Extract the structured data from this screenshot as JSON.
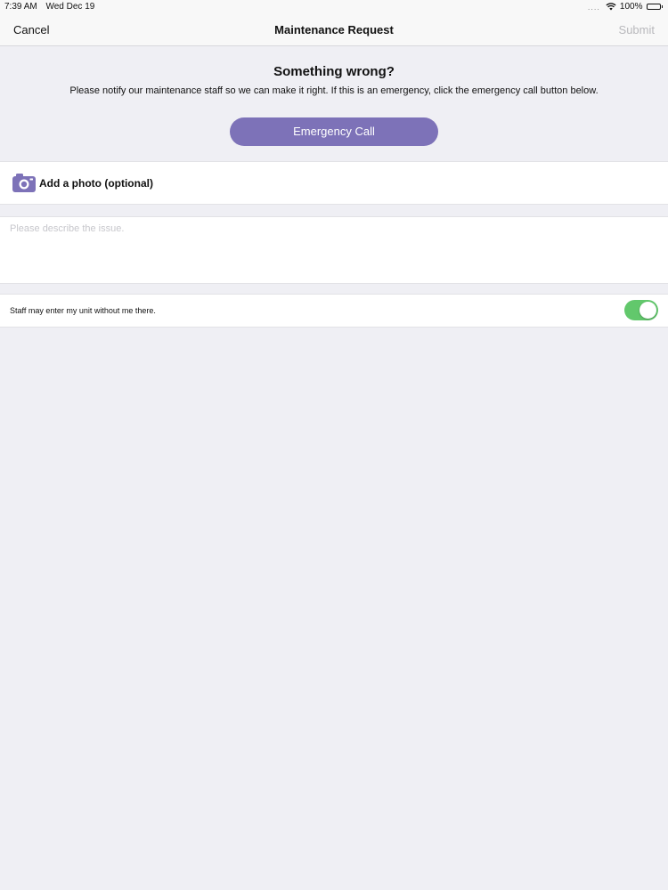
{
  "status_bar": {
    "time": "7:39 AM",
    "date": "Wed Dec 19",
    "signal": "....",
    "battery": "100%",
    "wifi_icon": "wifi-icon",
    "battery_icon": "battery-icon"
  },
  "nav": {
    "cancel_label": "Cancel",
    "title": "Maintenance Request",
    "submit_label": "Submit"
  },
  "intro": {
    "heading": "Something wrong?",
    "text": "Please notify our maintenance staff so we can make it right. If this is an emergency, click the emergency call button below."
  },
  "emergency_button": {
    "label": "Emergency Call",
    "color": "#7d72b8"
  },
  "photo_row": {
    "icon": "camera-icon",
    "label": "Add a photo (optional)"
  },
  "description": {
    "placeholder": "Please describe the issue.",
    "value": ""
  },
  "permission": {
    "label": "Staff may enter my unit without me there.",
    "toggle_on": true,
    "toggle_color": "#62c86c"
  }
}
